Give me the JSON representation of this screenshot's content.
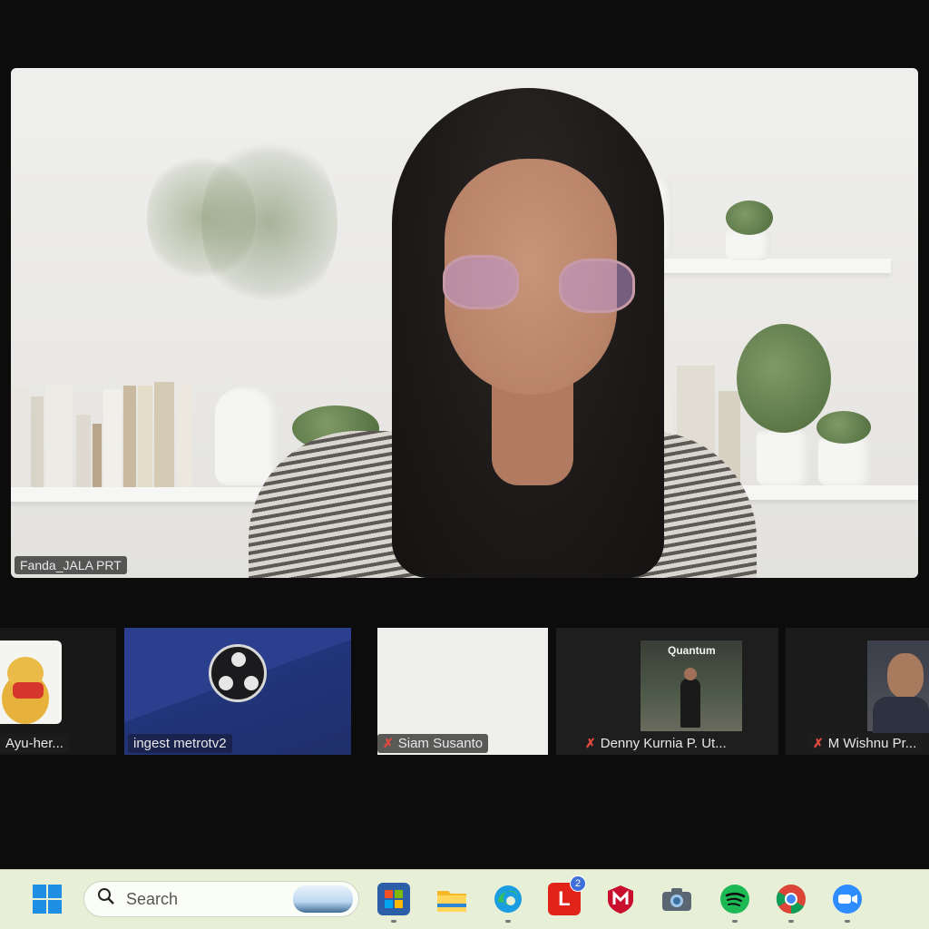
{
  "speaker": {
    "name": "Fanda_JALA PRT"
  },
  "participants": [
    {
      "name": "Ayu-her..."
    },
    {
      "name": "ingest metrotv2"
    },
    {
      "name": "Siam Susanto"
    },
    {
      "name": "Denny Kurnia P. Ut..."
    },
    {
      "name": "M Wishnu Pr..."
    }
  ],
  "denny_background_sign": "Quantum",
  "taskbar": {
    "search_placeholder": "Search",
    "icons": [
      "windows-start-icon",
      "search-icon",
      "microsoft-store-icon",
      "file-explorer-icon",
      "edge-icon",
      "office-l-icon",
      "mcafee-icon",
      "camera-icon",
      "spotify-icon",
      "chrome-icon",
      "zoom-icon"
    ],
    "office_badge": "2"
  },
  "colors": {
    "muted_mic": "#e2493f",
    "taskbar_bg": "#e8efd7",
    "obs_tile_bg": "#2b3f8e"
  }
}
